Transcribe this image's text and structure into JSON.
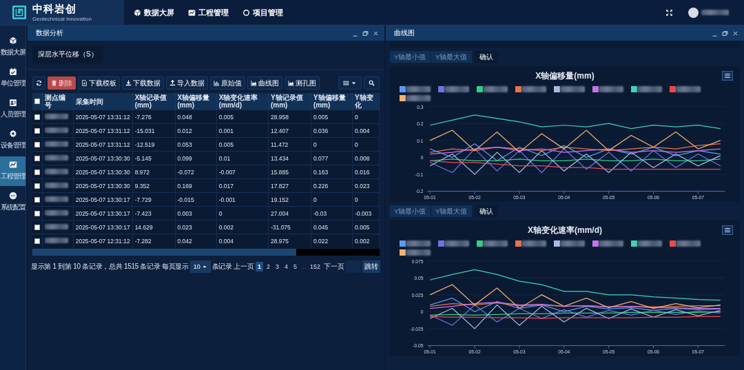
{
  "header": {
    "logo_title": "中科岩创",
    "logo_subtitle": "Geotechnical Innovation",
    "nav": [
      {
        "label": "数据大屏"
      },
      {
        "label": "工程管理"
      },
      {
        "label": "项目管理"
      }
    ]
  },
  "sidebar": {
    "items": [
      {
        "label": "数据大屏",
        "selected": false
      },
      {
        "label": "单位管理",
        "selected": false
      },
      {
        "label": "人员管理",
        "selected": false
      },
      {
        "label": "设备管理",
        "selected": false
      },
      {
        "label": "工程管理",
        "selected": true
      },
      {
        "label": "系统配置",
        "selected": false
      }
    ]
  },
  "left_panel": {
    "title": "数据分析",
    "tabs": [
      {
        "label": "深层水平位移（S）",
        "selected": true
      }
    ],
    "toolbar": [
      {
        "label": "删除",
        "kind": "danger"
      },
      {
        "label": "下载模板",
        "kind": "plain"
      },
      {
        "label": "下载数据",
        "kind": "plain"
      },
      {
        "label": "导入数据",
        "kind": "plain"
      },
      {
        "label": "原始值",
        "kind": "plain"
      },
      {
        "label": "曲线图",
        "kind": "plain"
      },
      {
        "label": "测孔图",
        "kind": "plain"
      }
    ],
    "table": {
      "header_checked": false,
      "columns": [
        "测点编号",
        "采集时间",
        "X轴记录值(mm)",
        "X轴偏移量(mm)",
        "X轴变化速率(mm/d)",
        "Y轴记录值(mm)",
        "Y轴偏移量(mm)",
        "Y轴变化"
      ],
      "rows": [
        {
          "checked": false,
          "cells": [
            "",
            "2025-05-07 13:31:12",
            "-7.276",
            "0.048",
            "0.005",
            "28.958",
            "0.005",
            "0"
          ]
        },
        {
          "checked": false,
          "cells": [
            "",
            "2025-05-07 13:31:12",
            "-15.031",
            "0.012",
            "0.001",
            "12.407",
            "0.036",
            "0.004"
          ]
        },
        {
          "checked": false,
          "cells": [
            "",
            "2025-05-07 13:31:12",
            "-12.519",
            "0.053",
            "0.005",
            "11.472",
            "0",
            "0"
          ]
        },
        {
          "checked": false,
          "cells": [
            "",
            "2025-05-07 13:30:30",
            "-5.145",
            "0.099",
            "0.01",
            "13.434",
            "0.077",
            "0.008"
          ]
        },
        {
          "checked": false,
          "cells": [
            "",
            "2025-05-07 13:30:30",
            "8.972",
            "-0.072",
            "-0.007",
            "15.885",
            "0.163",
            "0.016"
          ]
        },
        {
          "checked": false,
          "cells": [
            "",
            "2025-05-07 13:30:30",
            "9.352",
            "0.169",
            "0.017",
            "17.827",
            "0.226",
            "0.023"
          ]
        },
        {
          "checked": false,
          "cells": [
            "",
            "2025-05-07 13:30:17",
            "-7.729",
            "-0.015",
            "-0.001",
            "19.152",
            "0",
            "0"
          ]
        },
        {
          "checked": false,
          "cells": [
            "",
            "2025-05-07 13:30:17",
            "-7.423",
            "0.003",
            "0",
            "27.004",
            "-0.03",
            "-0.003"
          ]
        },
        {
          "checked": false,
          "cells": [
            "",
            "2025-05-07 13:30:17",
            "14.629",
            "0.023",
            "0.002",
            "-31.075",
            "0.045",
            "0.005"
          ]
        },
        {
          "checked": false,
          "cells": [
            "",
            "2025-05-07 12:31:12",
            "-7.282",
            "0.042",
            "0.004",
            "28.975",
            "0.022",
            "0.002"
          ]
        }
      ]
    },
    "pagination": {
      "summary": "显示第 1 到第 10 条记录，总共 1515 条记录 每页显示",
      "page_size": "10",
      "page_size_suffix": "条记录",
      "prev": "上一页",
      "pages": [
        {
          "label": "1",
          "kind": "page",
          "selected": true
        },
        {
          "label": "2",
          "kind": "page",
          "selected": false
        },
        {
          "label": "3",
          "kind": "page",
          "selected": false
        },
        {
          "label": "4",
          "kind": "page",
          "selected": false
        },
        {
          "label": "5",
          "kind": "page",
          "selected": false
        },
        {
          "label": "…",
          "kind": "gap"
        },
        {
          "label": "152",
          "kind": "page",
          "selected": false
        }
      ],
      "next": "下一页",
      "jump": "跳转"
    }
  },
  "right_panel": {
    "title": "曲线图",
    "charts": [
      {
        "min_placeholder": "Y轴最小值",
        "max_placeholder": "Y轴最大值",
        "confirm": "确认",
        "chart_data": {
          "type": "line",
          "title": "X轴偏移量(mm)",
          "grid": true,
          "categories": [
            "05-01",
            null,
            "05-02",
            null,
            "05-03",
            null,
            "05-04",
            null,
            "05-05",
            null,
            "05-06",
            null,
            "05-07",
            null
          ],
          "ylim": [
            -0.2,
            0.3
          ],
          "yticks": [
            -0.2,
            -0.1,
            0,
            0.1,
            0.2,
            0.3
          ],
          "series": [
            {
              "color": "#5b9bf0",
              "values": [
                0.05,
                0,
                0.08,
                -0.02,
                0.06,
                0.01,
                0.07,
                0,
                0.05,
                0.02,
                0.06,
                0.01,
                0.04,
                0.02
              ]
            },
            {
              "color": "#6f74e0",
              "values": [
                -0.03,
                -0.09,
                0.05,
                -0.08,
                0.04,
                -0.09,
                0.05,
                -0.07,
                0.03,
                -0.08,
                0.04,
                -0.06,
                0.02,
                -0.05
              ]
            },
            {
              "color": "#2fd184",
              "values": [
                -0.02,
                -0.01,
                -0.02,
                -0.02,
                -0.01,
                -0.02,
                -0.02,
                -0.01,
                -0.02,
                -0.02,
                -0.01,
                -0.02,
                -0.02,
                -0.01
              ]
            },
            {
              "color": "#f0704a",
              "values": [
                0.03,
                0.05,
                0.04,
                0.06,
                0.05,
                0.04,
                0.06,
                0.05,
                0.04,
                0.05,
                0.06,
                0.05,
                0.07,
                0.08
              ]
            },
            {
              "color": "#a8bde0",
              "values": [
                -0.05,
                0.02,
                -0.1,
                0.03,
                -0.09,
                0.04,
                -0.08,
                0.02,
                -0.09,
                0.03,
                -0.06,
                0.02,
                -0.05,
                0.01
              ]
            },
            {
              "color": "#c872ec",
              "values": [
                0.02,
                0.03,
                0.05,
                0.06,
                0.04,
                0.05,
                0.03,
                0.04,
                0.05,
                0.03,
                0.04,
                0.03,
                0.04,
                0.05
              ]
            },
            {
              "color": "#3fd4b4",
              "values": [
                0.19,
                0.22,
                0.25,
                0.23,
                0.21,
                0.18,
                0.19,
                0.18,
                0.2,
                0.17,
                0.19,
                0.18,
                0.19,
                0.17
              ]
            },
            {
              "color": "#f0474f",
              "values": [
                -0.02,
                -0.03,
                -0.03,
                -0.04,
                -0.05,
                -0.05,
                -0.06,
                -0.06,
                -0.07,
                -0.07,
                -0.07,
                -0.07,
                -0.07,
                -0.07
              ]
            },
            {
              "color": "#f6b26b",
              "values": [
                0.1,
                0.16,
                0.04,
                0.15,
                0.03,
                0.14,
                0.05,
                0.16,
                0.04,
                0.13,
                0.06,
                0.15,
                0.05,
                0.1
              ]
            }
          ]
        }
      },
      {
        "min_placeholder": "Y轴最小值",
        "max_placeholder": "Y轴最大值",
        "confirm": "确认",
        "chart_data": {
          "type": "line",
          "title": "X轴变化速率(mm/d)",
          "grid": true,
          "categories": [
            "05-01",
            null,
            "05-02",
            null,
            "05-03",
            null,
            "05-04",
            null,
            "05-05",
            null,
            "05-06",
            null,
            "05-07",
            null
          ],
          "ylim": [
            -0.05,
            0.075
          ],
          "yticks": [
            -0.05,
            -0.025,
            0,
            0.025,
            0.05,
            0.075
          ],
          "series": [
            {
              "color": "#5b9bf0",
              "values": [
                0.01,
                0.02,
                0,
                0.015,
                0.005,
                0.01,
                0,
                0.008,
                0.004,
                0.006,
                0.002,
                0.005,
                0.003,
                0.004
              ]
            },
            {
              "color": "#6f74e0",
              "values": [
                -0.005,
                -0.02,
                0.01,
                -0.015,
                0.005,
                -0.01,
                0.003,
                -0.008,
                0.002,
                -0.005,
                0.002,
                -0.004,
                0.001,
                -0.002
              ]
            },
            {
              "color": "#2fd184",
              "values": [
                -0.005,
                -0.004,
                -0.005,
                -0.004,
                -0.003,
                -0.003,
                -0.002,
                -0.002,
                -0.002,
                -0.001,
                -0.001,
                -0.001,
                -0.001,
                0
              ]
            },
            {
              "color": "#f0704a",
              "values": [
                0.008,
                0.012,
                0.01,
                0.013,
                0.009,
                0.01,
                0.008,
                0.009,
                0.007,
                0.008,
                0.007,
                0.008,
                0.009,
                0.009
              ]
            },
            {
              "color": "#a8bde0",
              "values": [
                -0.01,
                0.005,
                -0.025,
                0.01,
                -0.02,
                0.008,
                -0.015,
                0.005,
                -0.01,
                0.004,
                -0.008,
                0.003,
                -0.006,
                0.002
              ]
            },
            {
              "color": "#c872ec",
              "values": [
                0.005,
                0.008,
                0.012,
                0.014,
                0.01,
                0.011,
                0.008,
                0.009,
                0.007,
                0.008,
                0.006,
                0.006,
                0.005,
                0.005
              ]
            },
            {
              "color": "#3fd4b4",
              "values": [
                0.047,
                0.055,
                0.062,
                0.055,
                0.045,
                0.04,
                0.03,
                0.03,
                0.025,
                0.025,
                0.022,
                0.02,
                0.018,
                0.017
              ]
            },
            {
              "color": "#f0474f",
              "values": [
                -0.007,
                -0.008,
                -0.008,
                -0.009,
                -0.009,
                -0.01,
                -0.009,
                -0.009,
                -0.009,
                -0.009,
                -0.008,
                -0.008,
                -0.007,
                -0.007
              ]
            },
            {
              "color": "#f6b26b",
              "values": [
                0.025,
                0.04,
                0.01,
                0.035,
                0.005,
                0.025,
                0.008,
                0.02,
                0.006,
                0.015,
                0.005,
                0.012,
                0.006,
                0.01
              ]
            }
          ]
        }
      }
    ]
  }
}
